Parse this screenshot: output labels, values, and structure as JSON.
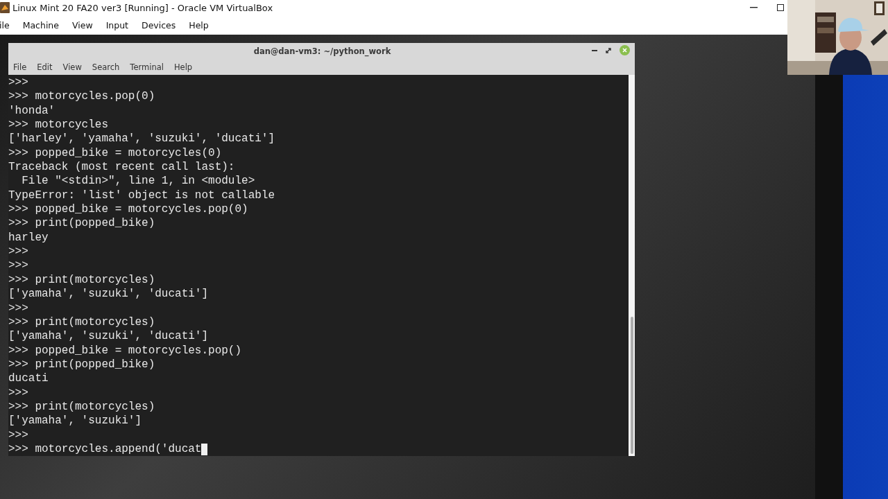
{
  "vm_window": {
    "title": "Linux Mint 20 FA20 ver3 [Running] - Oracle VM VirtualBox",
    "menu": [
      "ile",
      "Machine",
      "View",
      "Input",
      "Devices",
      "Help"
    ]
  },
  "terminal": {
    "title": "dan@dan-vm3: ~/python_work",
    "menu": [
      "File",
      "Edit",
      "View",
      "Search",
      "Terminal",
      "Help"
    ],
    "lines": [
      ">>>",
      ">>> motorcycles.pop(0)",
      "'honda'",
      ">>> motorcycles",
      "['harley', 'yamaha', 'suzuki', 'ducati']",
      ">>> popped_bike = motorcycles(0)",
      "Traceback (most recent call last):",
      "  File \"<stdin>\", line 1, in <module>",
      "TypeError: 'list' object is not callable",
      ">>> popped_bike = motorcycles.pop(0)",
      ">>> print(popped_bike)",
      "harley",
      ">>>",
      ">>>",
      ">>> print(motorcycles)",
      "['yamaha', 'suzuki', 'ducati']",
      ">>>",
      ">>> print(motorcycles)",
      "['yamaha', 'suzuki', 'ducati']",
      ">>> popped_bike = motorcycles.pop()",
      ">>> print(popped_bike)",
      "ducati",
      ">>>",
      ">>> print(motorcycles)",
      "['yamaha', 'suzuki']",
      ">>>",
      ">>> motorcycles.append('ducat"
    ]
  }
}
